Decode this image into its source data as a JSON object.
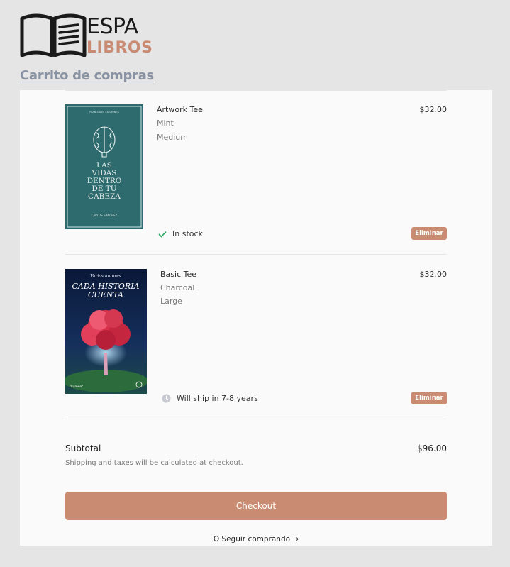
{
  "brand": {
    "name_top": "ESPA",
    "name_bottom": "LIBROS"
  },
  "page_title": "Carrito de compras",
  "cart": {
    "items": [
      {
        "name": "Artwork Tee",
        "color": "Mint",
        "size": "Medium",
        "price": "$32.00",
        "status": "In stock",
        "status_icon": "check-icon",
        "remove_label": "Eliminar",
        "cover": {
          "publisher": "PLAN SALEF EDICIONES",
          "title_lines": [
            "LAS",
            "VIDAS",
            "DENTRO",
            "DE TU",
            "CABEZA"
          ],
          "author": "CARLOS SÁNCHEZ",
          "bg": "#2e6b6e"
        }
      },
      {
        "name": "Basic Tee",
        "color": "Charcoal",
        "size": "Large",
        "price": "$32.00",
        "status": "Will ship in 7-8 years",
        "status_icon": "clock-icon",
        "remove_label": "Eliminar",
        "cover": {
          "author": "Varios autores",
          "title_lines": [
            "CADA HISTORIA",
            "CUENTA"
          ],
          "publisher": "\"kumen\"",
          "bg": "#0e1f45"
        }
      }
    ]
  },
  "summary": {
    "subtotal_label": "Subtotal",
    "subtotal_value": "$96.00",
    "shipping_note": "Shipping and taxes will be calculated at checkout."
  },
  "actions": {
    "checkout_label": "Checkout",
    "continue_label": "O Seguir comprando →"
  },
  "colors": {
    "accent": "#c98c73",
    "title": "#8a93a3",
    "check": "#22a55b"
  }
}
